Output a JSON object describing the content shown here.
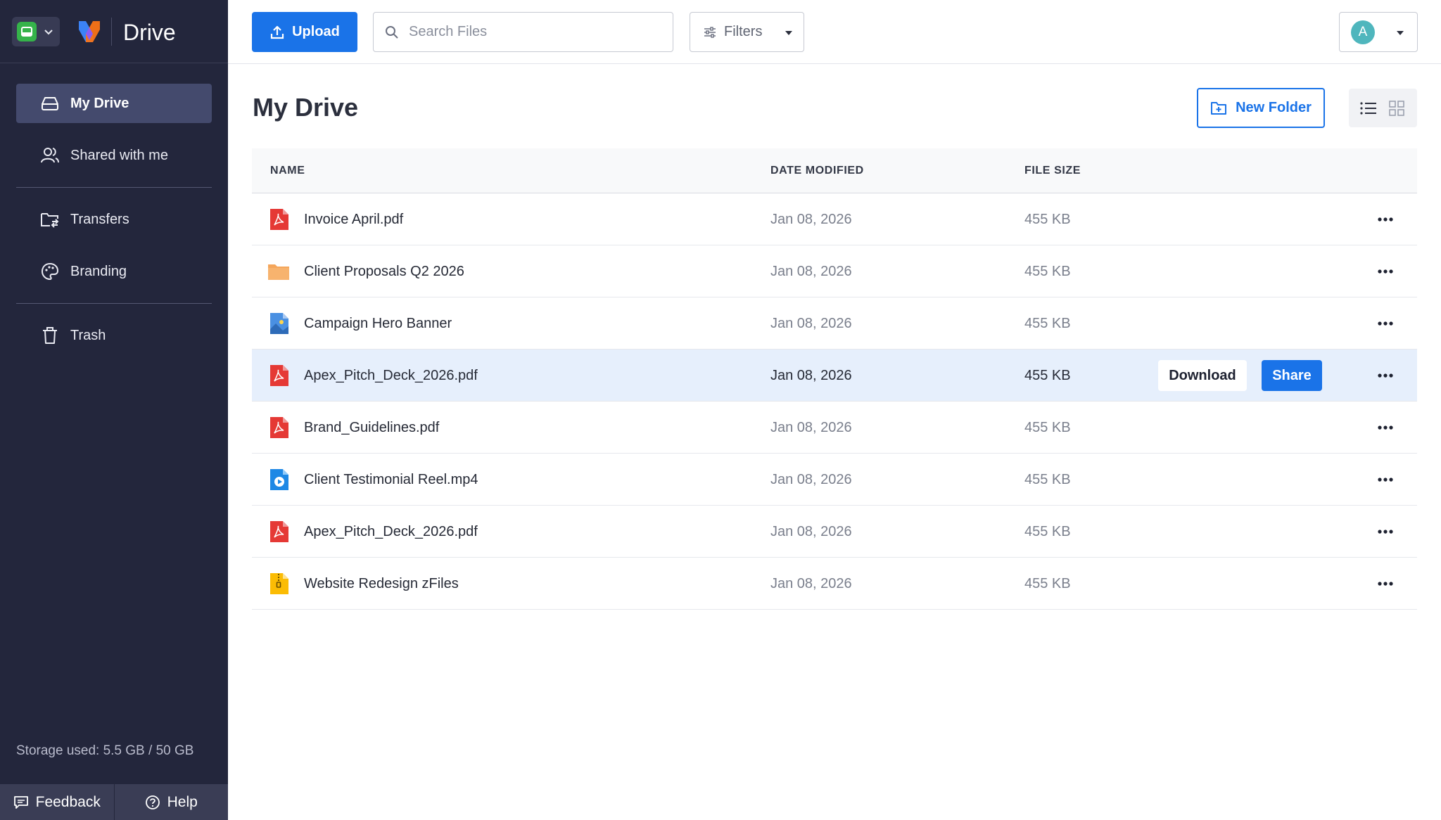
{
  "app": {
    "name": "Drive"
  },
  "sidebar": {
    "items": [
      {
        "label": "My Drive",
        "icon": "drive-icon",
        "active": true
      },
      {
        "label": "Shared with me",
        "icon": "users-icon"
      },
      {
        "label": "Transfers",
        "icon": "folder-transfer-icon"
      },
      {
        "label": "Branding",
        "icon": "palette-icon"
      },
      {
        "label": "Trash",
        "icon": "trash-icon"
      }
    ],
    "storage": "Storage used: 5.5 GB / 50 GB",
    "feedback_label": "Feedback",
    "help_label": "Help"
  },
  "toolbar": {
    "upload_label": "Upload",
    "search_placeholder": "Search Files",
    "filters_label": "Filters",
    "avatar_initial": "A"
  },
  "main": {
    "title": "My Drive",
    "new_folder_label": "New Folder",
    "columns": {
      "name": "NAME",
      "date": "DATE MODIFIED",
      "size": "FILE SIZE"
    },
    "files": [
      {
        "name": "Invoice April.pdf",
        "type": "pdf",
        "date": "Jan 08, 2026",
        "size": "455 KB"
      },
      {
        "name": "Client Proposals Q2 2026",
        "type": "folder",
        "date": "Jan 08, 2026",
        "size": "455 KB"
      },
      {
        "name": "Campaign Hero Banner",
        "type": "image",
        "date": "Jan 08, 2026",
        "size": "455 KB"
      },
      {
        "name": "Apex_Pitch_Deck_2026.pdf",
        "type": "pdf",
        "date": "Jan 08, 2026",
        "size": "455 KB",
        "selected": true
      },
      {
        "name": "Brand_Guidelines.pdf",
        "type": "pdf",
        "date": "Jan 08, 2026",
        "size": "455 KB"
      },
      {
        "name": "Client Testimonial Reel.mp4",
        "type": "video",
        "date": "Jan 08, 2026",
        "size": "455 KB"
      },
      {
        "name": "Apex_Pitch_Deck_2026.pdf",
        "type": "pdf",
        "date": "Jan 08, 2026",
        "size": "455 KB"
      },
      {
        "name": "Website Redesign zFiles",
        "type": "zip",
        "date": "Jan 08, 2026",
        "size": "455 KB"
      }
    ],
    "row_actions": {
      "download_label": "Download",
      "share_label": "Share"
    }
  },
  "colors": {
    "sidebar_bg": "#23263c",
    "accent": "#1a73e8",
    "selected_row": "#e6effc",
    "pdf_red": "#e53935",
    "folder_orange": "#f5a65b"
  }
}
